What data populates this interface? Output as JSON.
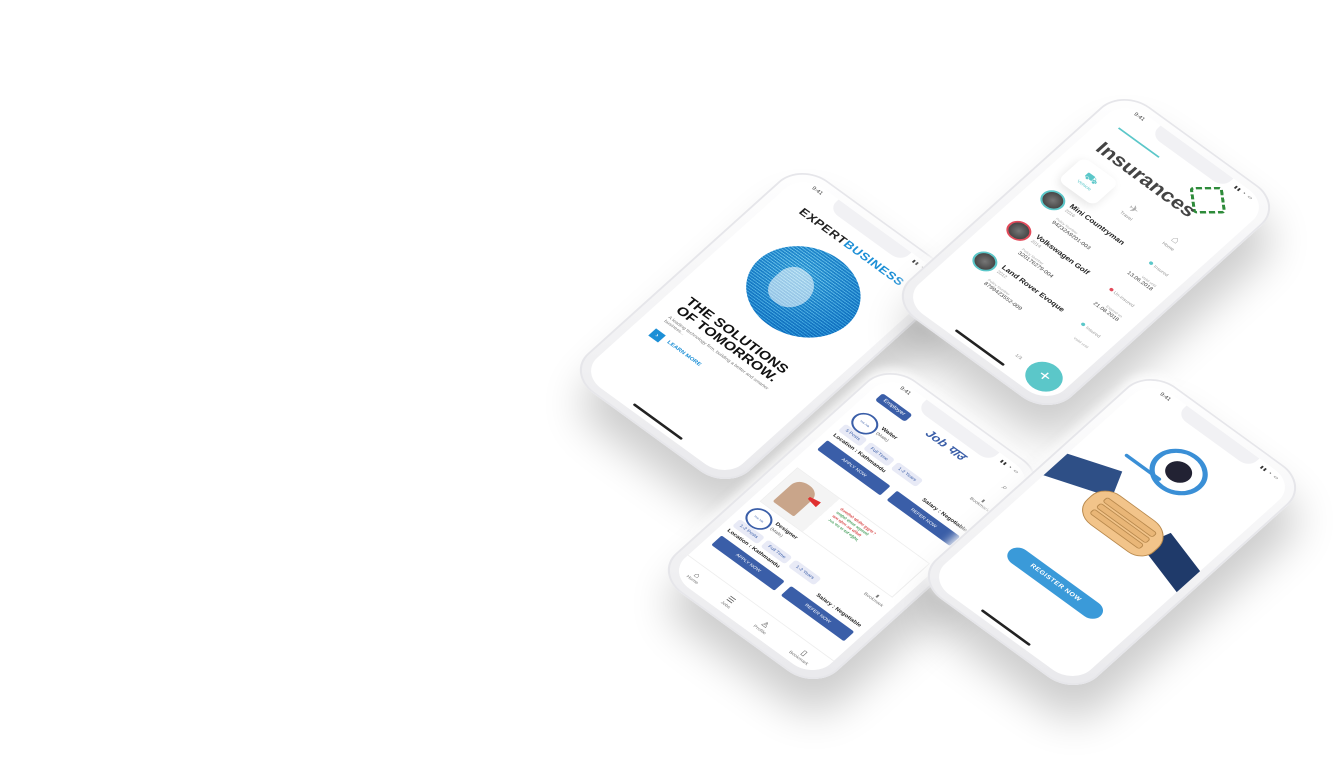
{
  "colors": {
    "expert_blue": "#1c8fd6",
    "insurance_teal": "#5bc7c9",
    "insurance_red": "#e24a5a",
    "job_blue": "#3a5ea8",
    "register_blue": "#3a9ad9"
  },
  "phone_expert": {
    "status_time": "9:41",
    "logo_prefix": "EXPERT",
    "logo_suffix": "BUSINESS",
    "heading": "THE SOLUTIONS OF TOMORROW.",
    "subtext": "A leading technology firm, building a better and smarter business...",
    "button_icon": "›",
    "learn_more": "LEARN MORE"
  },
  "phone_insurance": {
    "status_time": "9:41",
    "title": "Insurances",
    "categories": [
      {
        "label": "Vehicle",
        "icon": "car-icon"
      },
      {
        "label": "Travel",
        "icon": "plane-icon"
      },
      {
        "label": "Home",
        "icon": "home-icon"
      }
    ],
    "policies": [
      {
        "name": "Mini Countryman",
        "year": "2016",
        "policy_label": "Policy Number",
        "policy_number": "94232A9201-003",
        "valid_label": "Valid until",
        "valid_date": "13.06.2018",
        "status": "Insured"
      },
      {
        "name": "Volkswagen Golf",
        "year": "2014",
        "policy_label": "Policy Number",
        "policy_number": "320176279-004",
        "valid_label": "Expired on",
        "valid_date": "21.08.2018",
        "status": "Un-insured"
      },
      {
        "name": "Land Rover Evoque",
        "year": "2012",
        "policy_label": "Policy Number",
        "policy_number": "8799423552-009",
        "valid_label": "Valid until",
        "valid_date": "",
        "status": "Insured"
      }
    ],
    "pager": "1/3",
    "fab": "+"
  },
  "phone_job": {
    "status_time": "9:41",
    "employer_label": "Employer",
    "logo": "Job पाउ",
    "jobs": [
      {
        "badge": "Hot Job",
        "title": "Waiter",
        "subtitle": "(Male)",
        "save_label": "Bookmark",
        "chips": [
          "5 Posts",
          "Full Time",
          "1-2 Years"
        ],
        "location": "Location : Kathmandu",
        "salary": "Salary : Negotiable",
        "apply": "APPLY NOW",
        "refer": "REFER NOW"
      },
      {
        "badge": "Hot Job",
        "title": "Designer",
        "subtitle": "(Male)",
        "save_label": "Bookmark",
        "chips": [
          "1-2 Posts",
          "Full Time",
          "1-2 Years"
        ],
        "location": "Location : Kathmandu",
        "salary": "Salary : Negotiable",
        "apply": "APPLY NOW",
        "refer": "REFER NOW"
      }
    ],
    "ad_lines": [
      "रोजगारीको खोजीमा हुनुहुन्छ ?",
      "तपाईंको योग्यता अनुसारको",
      "काम खोज्न अब सजिलो",
      "Job पाउ मा दर्ता गर्नुहोस्"
    ],
    "nav": [
      {
        "label": "Home",
        "icon": "home-icon"
      },
      {
        "label": "Jobs",
        "icon": "list-icon"
      },
      {
        "label": "Profile",
        "icon": "user-icon"
      },
      {
        "label": "Bookmark",
        "icon": "bookmark-icon"
      }
    ]
  },
  "phone_register": {
    "status_time": "9:41",
    "register_button": "REGISTER NOW"
  }
}
